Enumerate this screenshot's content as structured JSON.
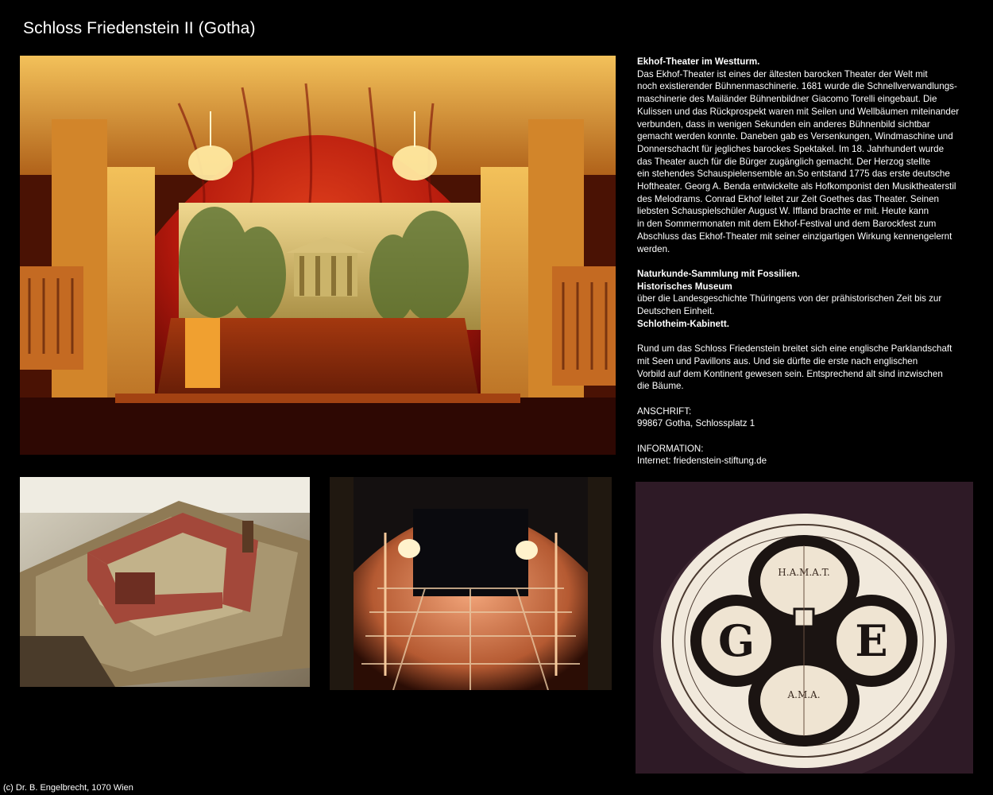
{
  "page": {
    "title": "Schloss Friedenstein II (Gotha)",
    "footer": "(c) Dr. B. Engelbrecht, 1070 Wien"
  },
  "photos": {
    "theater": "Ekhof-Theater stage photo",
    "model": "castle model photo",
    "machinery": "stage machinery photo",
    "dial": "engraved dial photo"
  },
  "text": {
    "theater_heading": "Ekhof-Theater im Westturm.",
    "theater_lines": [
      "Das Ekhof-Theater ist eines der ältesten barocken Theater der Welt mit",
      "noch existierender Bühnenmaschinerie. 1681 wurde die Schnellverwandlungs-",
      "maschinerie des Mailänder Bühnenbildner Giacomo Torelli eingebaut. Die",
      "Kulissen und das Rückprospekt waren mit Seilen und Wellbäumen miteinander",
      "verbunden, dass in wenigen Sekunden ein anderes Bühnenbild sichtbar",
      "gemacht werden konnte. Daneben gab es Versenkungen, Windmaschine und",
      "Donnerschacht für jegliches barockes Spektakel. Im 18. Jahrhundert wurde",
      "das Theater auch für die Bürger zugänglich gemacht. Der Herzog stellte",
      "ein stehendes Schauspielensemble an.So entstand 1775 das erste deutsche",
      "Hoftheater. Georg A. Benda entwickelte als Hofkomponist den Musiktheaterstil",
      "des Melodrams. Conrad Ekhof leitet zur Zeit Goethes das Theater. Seinen",
      "liebsten Schauspielschüler August W. Iffland brachte er mit. Heute kann",
      "in den Sommermonaten mit dem Ekhof-Festival und dem Barockfest zum",
      "Abschluss das Ekhof-Theater mit seiner einzigartigen Wirkung kennengelernt",
      "werden."
    ],
    "naturkunde": "Naturkunde-Sammlung mit Fossilien.",
    "museum_heading": "Historisches Museum",
    "museum_lines": [
      "über die Landesgeschichte Thüringens von der prähistorischen Zeit bis zur",
      "Deutschen Einheit."
    ],
    "kabinett": "Schlotheim-Kabinett.",
    "park_lines": [
      "Rund um das Schloss Friedenstein breitet sich eine englische Parklandschaft",
      "mit Seen und Pavillons aus. Und sie dürfte die erste nach englischen",
      "Vorbild auf dem Kontinent gewesen sein. Entsprechend alt sind inzwischen",
      "die Bäume."
    ],
    "address_label": "ANSCHRIFT:",
    "address": "99867 Gotha, Schlossplatz 1",
    "info_label": "INFORMATION:",
    "info": "Internet: friedenstein-stiftung.de"
  },
  "dial": {
    "letter_left": "G",
    "letter_right": "E",
    "cartouche_top": "H.A.M.A.T.",
    "cartouche_bottom": "A.M.A."
  },
  "colors": {
    "background": "#000000",
    "text": "#ffffff",
    "theater_red": "#b3180c",
    "gold": "#e2a23a"
  }
}
